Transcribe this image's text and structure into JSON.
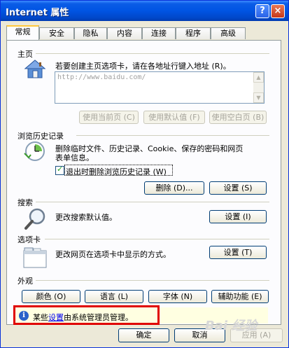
{
  "window": {
    "title": "Internet 属性",
    "help_glyph": "?",
    "close_glyph": "×"
  },
  "tabs": [
    "常规",
    "安全",
    "隐私",
    "内容",
    "连接",
    "程序",
    "高级"
  ],
  "homepage": {
    "section_label": "主页",
    "description": "若要创建主页选项卡，请在各地址行键入地址 (R)。",
    "url": "http://www.baidu.com/",
    "buttons": {
      "use_current": "使用当前页 (C)",
      "use_default": "使用默认值 (F)",
      "use_blank": "使用空白页 (B)"
    }
  },
  "history": {
    "section_label": "浏览历史记录",
    "description_line1": "删除临时文件、历史记录、Cookie、保存的密码和网页",
    "description_line2": "表单信息。",
    "checkbox_label": "退出时删除浏览历史记录 (W)",
    "checkbox_checked": true,
    "delete_button": "删除 (D)...",
    "settings_button": "设置 (S)"
  },
  "search": {
    "section_label": "搜索",
    "description": "更改搜索默认值。",
    "settings_button": "设置 (I)"
  },
  "tabs_section": {
    "section_label": "选项卡",
    "description": "更改网页在选项卡中显示的方式。",
    "settings_button": "设置 (T)"
  },
  "appearance": {
    "section_label": "外观",
    "buttons": {
      "colors": "颜色 (O)",
      "languages": "语言 (L)",
      "fonts": "字体 (N)",
      "accessibility": "辅助功能 (E)"
    }
  },
  "infobar": {
    "prefix": "某些",
    "link": "设置",
    "suffix": "由系统管理员管理。"
  },
  "footer": {
    "ok": "确定",
    "cancel": "取消",
    "apply": "应用 (A)"
  },
  "watermark": "Bai 经验"
}
